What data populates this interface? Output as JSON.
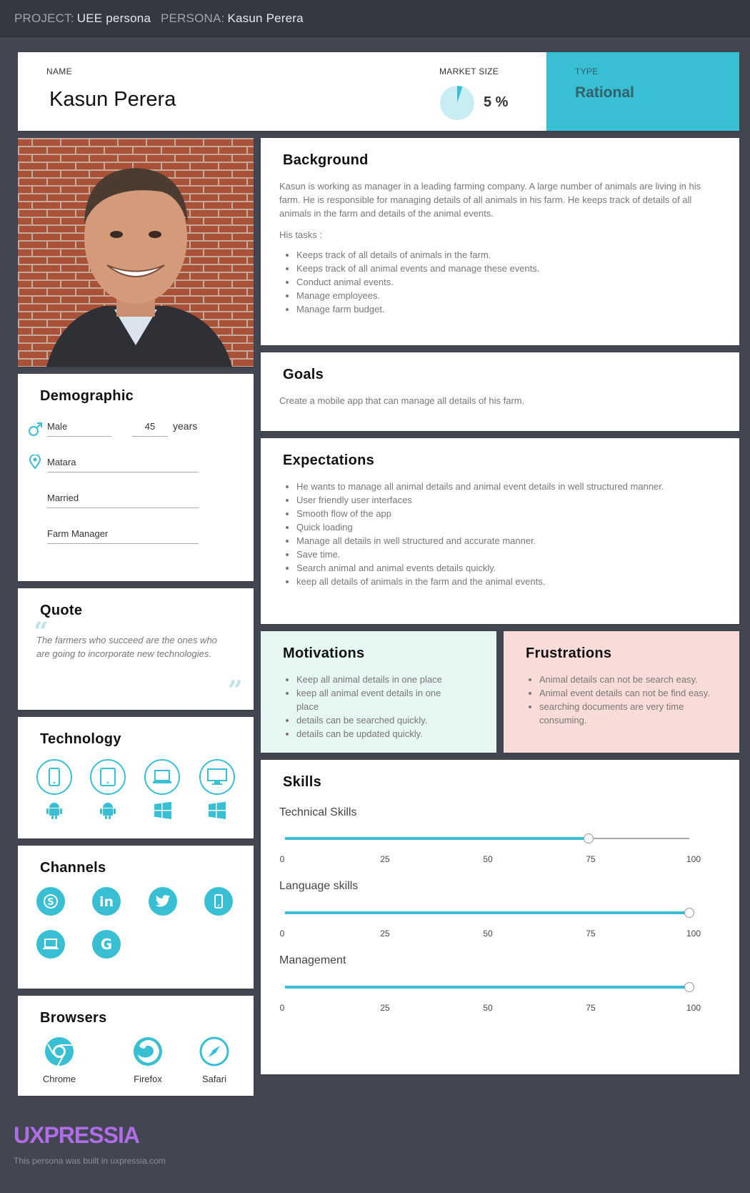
{
  "topbar": {
    "project_label": "PROJECT:",
    "project": "UEE persona",
    "persona_label": "PERSONA:",
    "persona": "Kasun Perera"
  },
  "header": {
    "name_label": "NAME",
    "name": "Kasun Perera",
    "market_label": "MARKET SIZE",
    "market_value": "5 %",
    "market_fraction": 0.05,
    "type_label": "TYPE",
    "type_value": "Rational"
  },
  "background": {
    "title": "Background",
    "text": "Kasun is working as manager in a leading farming company. A large number of animals are living in his farm. He is responsible for managing details of all animals in his farm. He keeps track of details of all animals in the farm and details of the animal events.",
    "tasks_label": "His tasks :",
    "tasks": [
      "Keeps track of all details of animals in the farm.",
      "Keeps track of all animal events and manage these events.",
      "Conduct animal events.",
      "Manage employees.",
      "Manage farm budget."
    ]
  },
  "goals": {
    "title": "Goals",
    "text": "Create a mobile app that can manage all details of his farm."
  },
  "expectations": {
    "title": "Expectations",
    "items": [
      "He wants to manage all animal details and animal event details  in well structured manner.",
      "User friendly user interfaces",
      "Smooth flow of the app",
      "Quick loading",
      "Manage all details in well structured and accurate manner.",
      "Save time.",
      "Search animal and animal events details quickly.",
      "keep all details of animals in the farm and the animal events."
    ]
  },
  "motivations": {
    "title": "Motivations",
    "items": [
      "Keep all animal details in one place",
      "keep all animal event details in one place",
      "details can be searched quickly.",
      "details can be updated quickly."
    ],
    "bg": "#e6f6f3"
  },
  "frustrations": {
    "title": "Frustrations",
    "items": [
      "Animal details can not be search easy.",
      "Animal event details can not be find easy.",
      "searching documents are very time consuming."
    ],
    "bg": "#f9dcd8"
  },
  "demographic": {
    "title": "Demographic",
    "gender": "Male",
    "age": "45",
    "age_unit": "years",
    "location": "Matara",
    "status": "Married",
    "occupation": "Farm Manager"
  },
  "quote": {
    "title": "Quote",
    "text": "The farmers who succeed are the ones who are going to incorporate new technologies."
  },
  "technology": {
    "title": "Technology",
    "devices": [
      "phone-icon",
      "tablet-icon",
      "laptop-icon",
      "desktop-icon"
    ],
    "os": [
      "android-icon",
      "android-icon",
      "windows-icon",
      "windows-icon"
    ]
  },
  "channels": {
    "title": "Channels",
    "items": [
      "skype-icon",
      "linkedin-icon",
      "twitter-icon",
      "mobile-icon",
      "laptop-icon",
      "google-icon"
    ]
  },
  "browsers": {
    "title": "Browsers",
    "items": [
      {
        "name": "Chrome"
      },
      {
        "name": "Firefox"
      },
      {
        "name": "Safari"
      }
    ]
  },
  "skills": {
    "title": "Skills",
    "ticks": [
      "0",
      "25",
      "50",
      "75",
      "100"
    ],
    "items": [
      {
        "name": "Technical Skills",
        "value": 75
      },
      {
        "name": "Language skills",
        "value": 100
      },
      {
        "name": "Management",
        "value": 100
      }
    ]
  },
  "footer": {
    "logo": "UXPRESSIA",
    "note": "This persona was built in uxpressia.com"
  },
  "colors": {
    "accent": "#38bfd4",
    "page_bg": "#424650",
    "logo": "#b06de8"
  }
}
